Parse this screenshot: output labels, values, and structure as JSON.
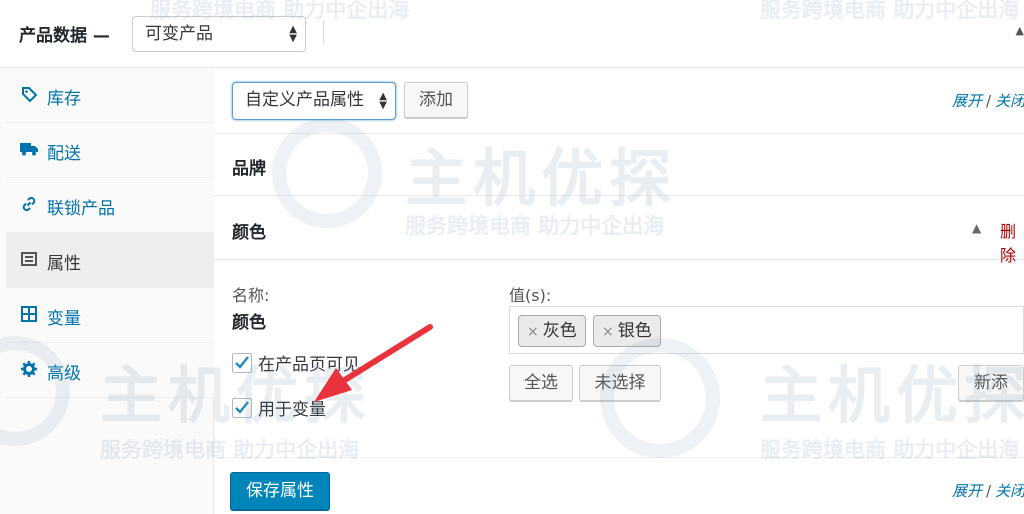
{
  "header": {
    "title": "产品数据 —",
    "product_type": "可变产品",
    "collapse_icon": "triangle-up-icon"
  },
  "sidebar": {
    "items": [
      {
        "label": "库存",
        "icon": "tag-icon"
      },
      {
        "label": "配送",
        "icon": "truck-icon"
      },
      {
        "label": "联锁产品",
        "icon": "link-icon"
      },
      {
        "label": "属性",
        "icon": "list-icon",
        "active": true
      },
      {
        "label": "变量",
        "icon": "grid-icon"
      },
      {
        "label": "高级",
        "icon": "gear-icon"
      }
    ]
  },
  "toolbar": {
    "attribute_select": "自定义产品属性",
    "add_label": "添加",
    "expand_label": "展开",
    "close_label": "关闭"
  },
  "attributes": [
    {
      "name": "品牌"
    },
    {
      "name": "颜色",
      "delete_label": "删除"
    }
  ],
  "attribute_detail": {
    "name_label": "名称:",
    "name_value": "颜色",
    "values_label": "值(s):",
    "values": [
      "灰色",
      "银色"
    ],
    "visible_on_product_page_label": "在产品页可见",
    "visible_on_product_page": true,
    "used_for_variations_label": "用于变量",
    "used_for_variations": true,
    "select_all_label": "全选",
    "select_none_label": "未选择",
    "add_new_label": "新添"
  },
  "footer": {
    "save_label": "保存属性",
    "expand_label": "展开",
    "close_label": "关闭"
  },
  "watermark": {
    "logo_text": "主机优探",
    "tagline": "服务跨境电商 助力中企出海"
  },
  "colors": {
    "accent": "#0073aa",
    "primary_button": "#0085ba",
    "delete": "#aa0000",
    "arrow": "#e8323c"
  }
}
